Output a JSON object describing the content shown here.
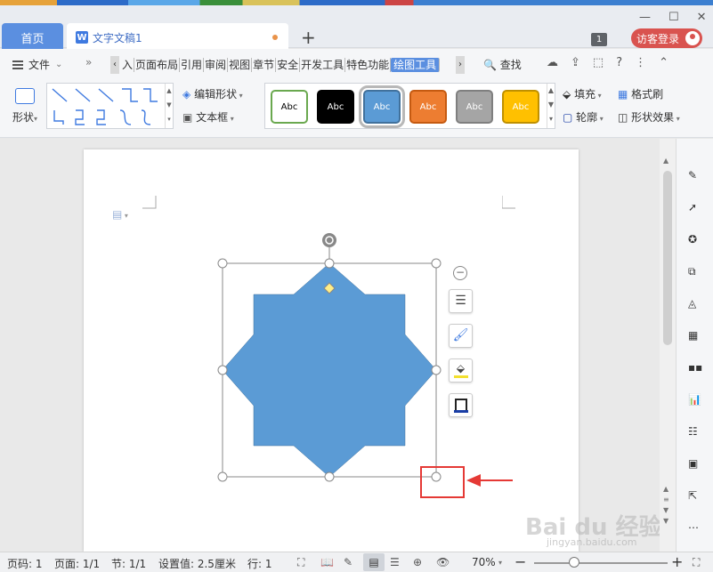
{
  "titlebar": {
    "home_tab": "首页",
    "doc_tab": "文字文稿1",
    "doc_icon_letter": "W",
    "new_tab": "+",
    "count_badge": "1",
    "guest_login": "访客登录"
  },
  "menubar": {
    "file": "文件",
    "more": "»",
    "items": [
      "入",
      "页面布局",
      "引用",
      "审阅",
      "视图",
      "章节",
      "安全",
      "开发工具",
      "特色功能",
      "绘图工具"
    ],
    "active_item": "绘图工具",
    "search": "查找"
  },
  "ribbon": {
    "shape": "形状",
    "edit_shape": "编辑形状",
    "textbox": "文本框",
    "style_label": "Abc",
    "styles": [
      {
        "bg": "#ffffff",
        "border": "#6aa84f",
        "fg": "#000000"
      },
      {
        "bg": "#000000",
        "border": "#000000",
        "fg": "#ffffff"
      },
      {
        "bg": "#5b9bd5",
        "border": "#41719c",
        "fg": "#ffffff"
      },
      {
        "bg": "#ed7d31",
        "border": "#c55a11",
        "fg": "#ffffff"
      },
      {
        "bg": "#a5a5a5",
        "border": "#7f7f7f",
        "fg": "#ffffff"
      },
      {
        "bg": "#ffc000",
        "border": "#bf9000",
        "fg": "#ffffff"
      }
    ],
    "fill": "填充",
    "format_brush": "格式刷",
    "outline": "轮廓",
    "shape_effect": "形状效果"
  },
  "canvas": {
    "shape_color": "#5b9bd5",
    "highlight_color": "#e53935"
  },
  "statusbar": {
    "page_no": "页码: 1",
    "page": "页面: 1/1",
    "section": "节: 1/1",
    "setting": "设置值: 2.5厘米",
    "row": "行: 1",
    "zoom": "70%"
  },
  "watermark": {
    "main": "Bai du 经验",
    "sub": "jingyan.baidu.com"
  }
}
